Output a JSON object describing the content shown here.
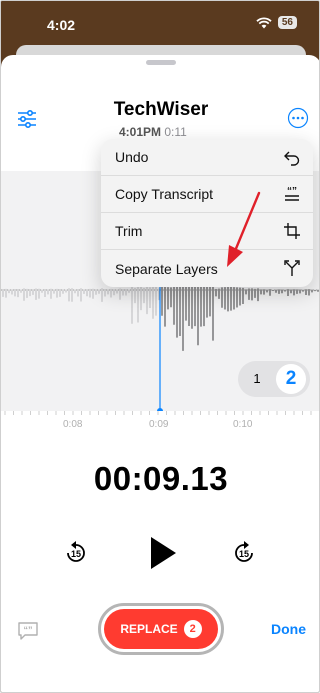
{
  "status_bar": {
    "time": "4:02",
    "battery": "56"
  },
  "recording": {
    "title": "TechWiser",
    "time": "4:01PM",
    "duration": "0:11"
  },
  "menu": {
    "items": [
      {
        "label": "Undo",
        "icon": "undo-arrow-icon"
      },
      {
        "label": "Copy Transcript",
        "icon": "transcript-quote-icon"
      },
      {
        "label": "Trim",
        "icon": "crop-icon"
      },
      {
        "label": "Separate Layers",
        "icon": "split-icon"
      }
    ]
  },
  "waveform": {
    "ruler_labels": [
      "0:08",
      "0:09",
      "0:10"
    ],
    "layer_options": [
      "1",
      "2"
    ],
    "selected_layer": "2"
  },
  "playback": {
    "timer": "00:09.13",
    "skip_back": "15",
    "skip_forward": "15"
  },
  "footer": {
    "replace_label": "REPLACE",
    "replace_count": "2",
    "done_label": "Done"
  },
  "colors": {
    "accent": "#0a84ff",
    "record_red": "#ff3b30",
    "annotation_red": "#e0202a"
  }
}
